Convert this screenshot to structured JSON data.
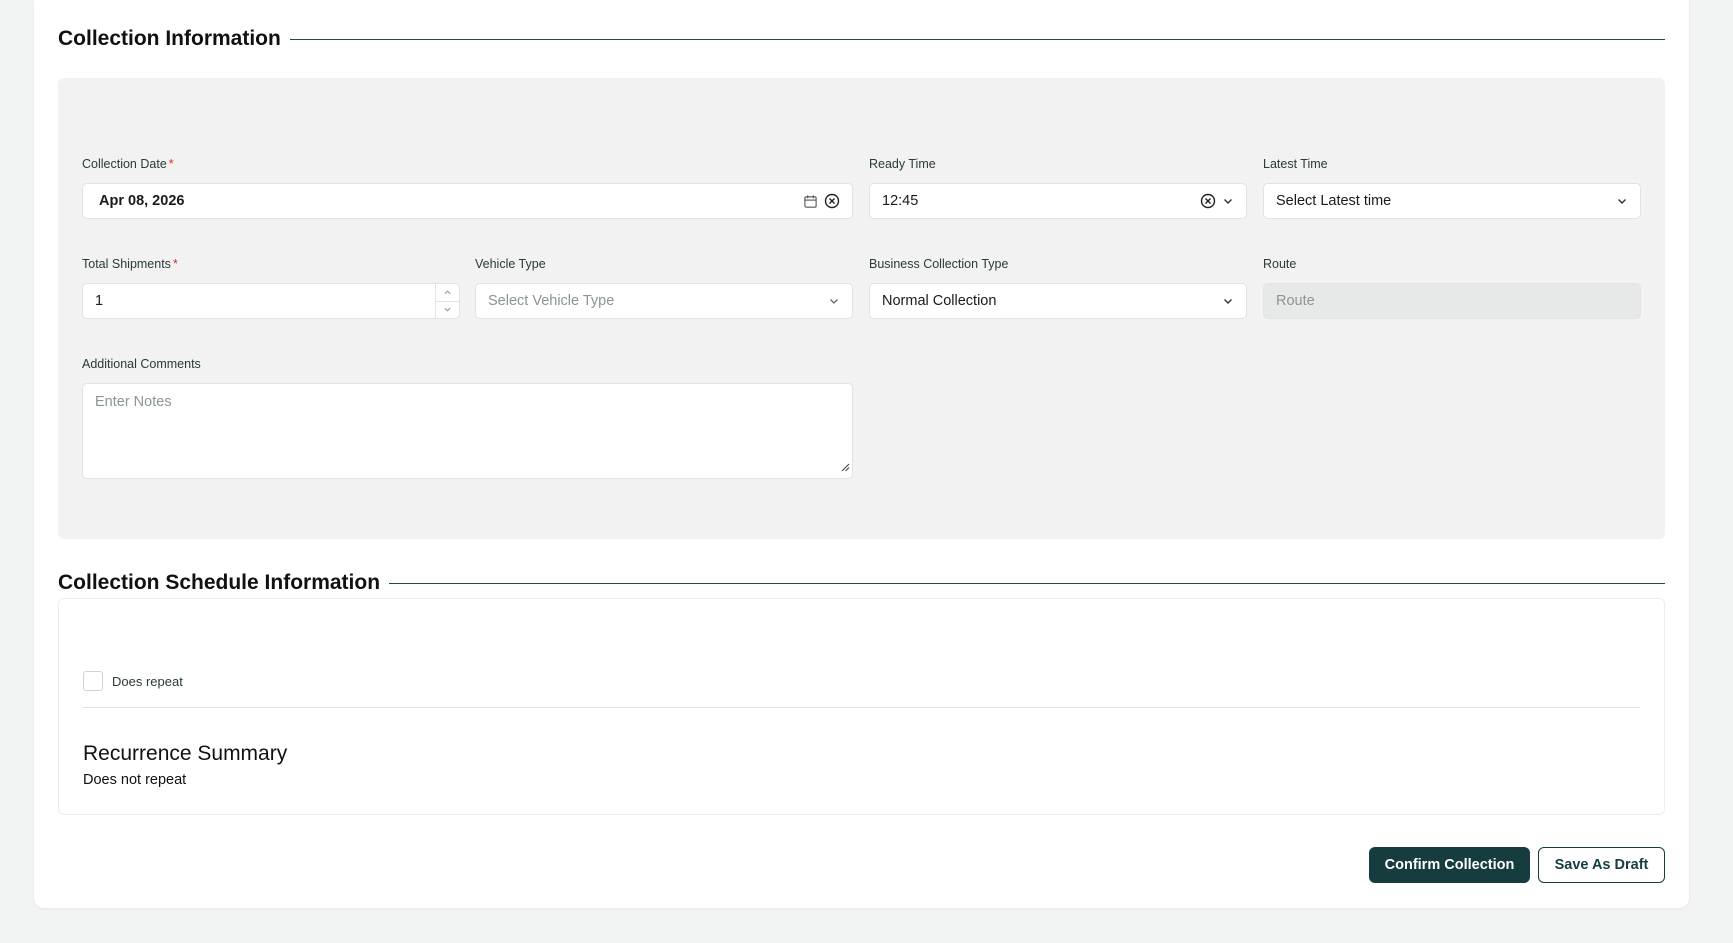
{
  "collection_info": {
    "title": "Collection Information",
    "collection_date": {
      "label": "Collection Date",
      "required": "*",
      "value": "Apr 08, 2026"
    },
    "ready_time": {
      "label": "Ready Time",
      "value": "12:45"
    },
    "latest_time": {
      "label": "Latest Time",
      "placeholder": "Select Latest time"
    },
    "total_shipments": {
      "label": "Total Shipments",
      "required": "*",
      "value": "1"
    },
    "vehicle_type": {
      "label": "Vehicle Type",
      "placeholder": "Select Vehicle Type"
    },
    "business_collection_type": {
      "label": "Business Collection Type",
      "value": "Normal Collection"
    },
    "route": {
      "label": "Route",
      "placeholder": "Route"
    },
    "additional_comments": {
      "label": "Additional Comments",
      "placeholder": "Enter Notes"
    }
  },
  "schedule_info": {
    "title": "Collection Schedule Information",
    "does_repeat_label": "Does repeat",
    "does_repeat_checked": false,
    "recurrence_title": "Recurrence Summary",
    "recurrence_text": "Does not repeat"
  },
  "actions": {
    "confirm_label": "Confirm Collection",
    "draft_label": "Save As Draft"
  },
  "colors": {
    "accent": "#173c40",
    "required": "#d0312d",
    "panel_bg": "#f1f2f1"
  }
}
